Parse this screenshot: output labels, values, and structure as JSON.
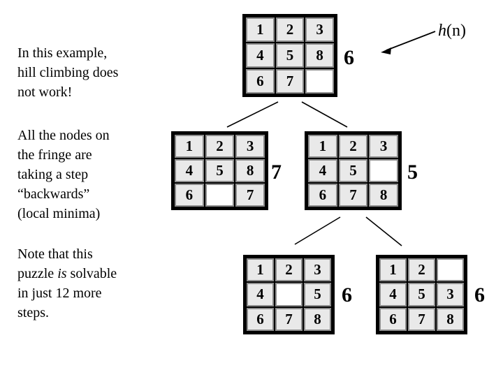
{
  "notes": {
    "block1": "In this example,\nhill climbing does\nnot work!",
    "block2": "All the nodes on\nthe fringe are\ntaking a step\n“backwards”\n(local minima)",
    "block3_part1": "Note that this\npuzzle ",
    "block3_italic": "is",
    "block3_part2": " solvable\nin just 12 more\nsteps."
  },
  "annotation": {
    "h_italic": "h",
    "h_rest": "(n)",
    "arrow": "left-arrow-to-heuristic-value"
  },
  "boards": {
    "root": {
      "label": "root-state",
      "tiles": [
        "1",
        "2",
        "3",
        "4",
        "5",
        "8",
        "6",
        "7",
        ""
      ],
      "h": "6"
    },
    "left": {
      "label": "child-left-state",
      "tiles": [
        "1",
        "2",
        "3",
        "4",
        "5",
        "8",
        "6",
        "",
        "7"
      ],
      "h": "7"
    },
    "right": {
      "label": "child-right-state",
      "tiles": [
        "1",
        "2",
        "3",
        "4",
        "5",
        "",
        "6",
        "7",
        "8"
      ],
      "h": "5"
    },
    "bottomleft": {
      "label": "grandchild-left-state",
      "tiles": [
        "1",
        "2",
        "3",
        "4",
        "",
        "5",
        "6",
        "7",
        "8"
      ],
      "h": "6"
    },
    "bottomright": {
      "label": "grandchild-right-state",
      "tiles": [
        "1",
        "2",
        "",
        "4",
        "5",
        "3",
        "6",
        "7",
        "8"
      ],
      "h": "6"
    }
  },
  "colors": {
    "tile_fill": "#e9e9e9",
    "tile_border": "#8c8c8c",
    "board_border": "#000000",
    "blank_fill": "#ffffff",
    "text": "#000000"
  }
}
